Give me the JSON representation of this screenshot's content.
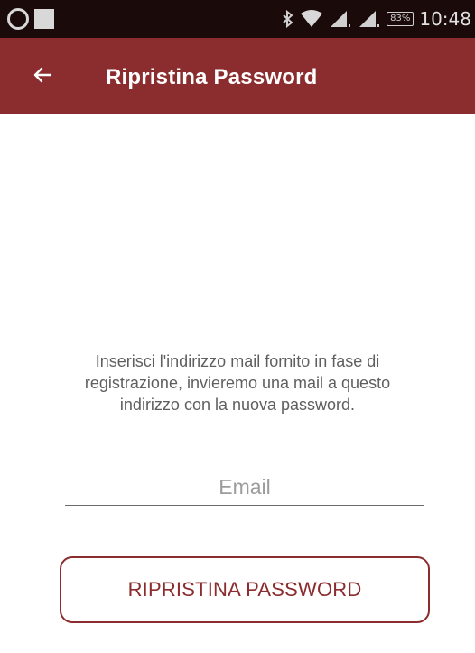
{
  "status_bar": {
    "battery": "83%",
    "time": "10:48",
    "icons": [
      "record-icon",
      "square-icon",
      "bluetooth-icon",
      "wifi-icon",
      "signal-icon",
      "signal-icon",
      "battery-icon"
    ]
  },
  "app_bar": {
    "back_icon": "arrow-left-icon",
    "title": "Ripristina Password",
    "background": "#8b2c2e"
  },
  "content": {
    "instructions": "Inserisci l'indirizzo mail fornito in fase di registrazione, invieremo una mail a questo indirizzo con la nuova password.",
    "email": {
      "placeholder": "Email",
      "value": ""
    },
    "reset_button_label": "RIPRISTINA PASSWORD"
  },
  "colors": {
    "accent": "#8b2c2e",
    "text": "#5f5f5f"
  }
}
